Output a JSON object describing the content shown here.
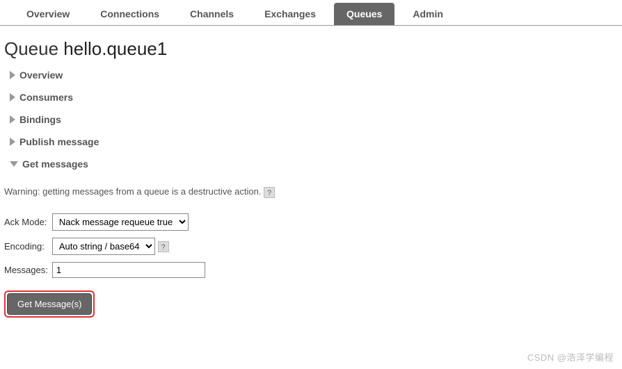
{
  "tabs": {
    "items": [
      "Overview",
      "Connections",
      "Channels",
      "Exchanges",
      "Queues",
      "Admin"
    ],
    "active_index": 4
  },
  "page": {
    "title_prefix": "Queue ",
    "queue_name": "hello.queue1"
  },
  "sections": {
    "overview": "Overview",
    "consumers": "Consumers",
    "bindings": "Bindings",
    "publish": "Publish message",
    "get": "Get messages"
  },
  "get_messages": {
    "warning": "Warning: getting messages from a queue is a destructive action.",
    "help": "?",
    "ack_mode_label": "Ack Mode:",
    "ack_mode_value": "Nack message requeue true",
    "encoding_label": "Encoding:",
    "encoding_value": "Auto string / base64",
    "messages_label": "Messages:",
    "messages_value": "1",
    "button": "Get Message(s)"
  },
  "watermark": "CSDN @浩泽学编程"
}
